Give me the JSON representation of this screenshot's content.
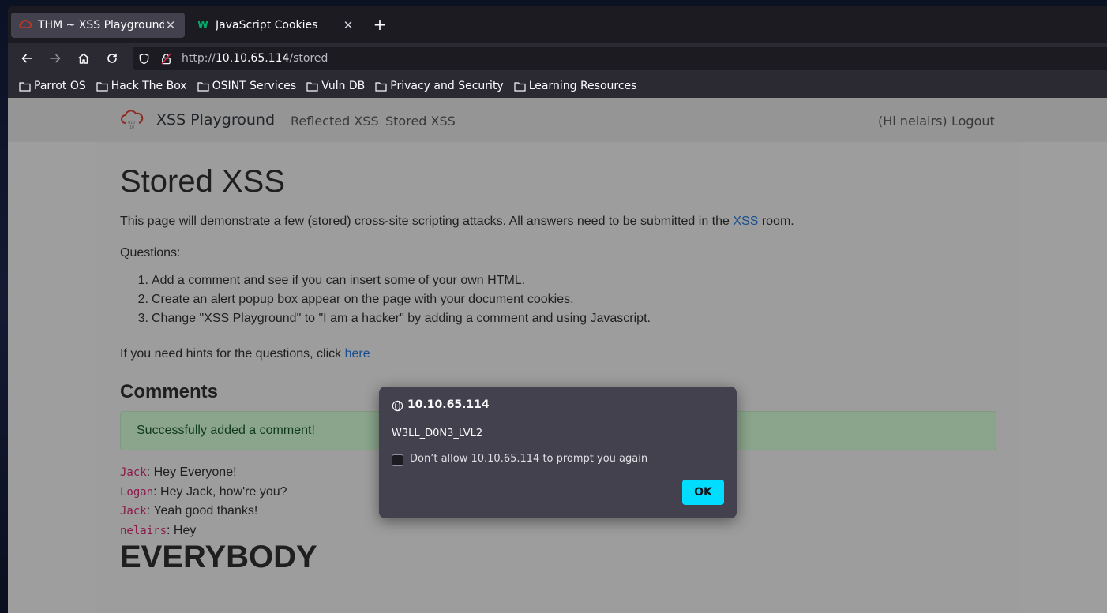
{
  "browser": {
    "tabs": [
      {
        "title": "THM ~ XSS Playground",
        "active": true
      },
      {
        "title": "JavaScript Cookies",
        "active": false
      }
    ],
    "url": {
      "prefix": "http://",
      "host": "10.10.65.114",
      "path": "/stored"
    },
    "bookmarks": [
      "Parrot OS",
      "Hack The Box",
      "OSINT Services",
      "Vuln DB",
      "Privacy and Security",
      "Learning Resources"
    ],
    "colors": {
      "accent": "#00ddff",
      "tab_active": "#42414d",
      "toolbar": "#2b2a33"
    }
  },
  "site": {
    "brand": "XSS Playground",
    "nav": {
      "reflected": "Reflected XSS",
      "stored": "Stored XSS",
      "user": "(Hi nelairs)",
      "logout": "Logout"
    }
  },
  "main": {
    "title": "Stored XSS",
    "intro_before": "This page will demonstrate a few (stored) cross-site scripting attacks. All answers need to be submitted in the ",
    "intro_link": "XSS",
    "intro_after": " room.",
    "questions_label": "Questions:",
    "questions": [
      {
        "num": "1.",
        "text": "Add a comment and see if you can insert some of your own HTML."
      },
      {
        "num": "2.",
        "text": "Create an alert popup box appear on the page with your document cookies."
      },
      {
        "num": "3.",
        "text": "Change \"XSS Playground\" to \"I am a hacker\" by adding a comment and using Javascript."
      }
    ],
    "hint_before": "If you need hints for the questions, click ",
    "hint_link": "here",
    "comments_title": "Comments",
    "success_message": "Successfully added a comment!",
    "comments": [
      {
        "author": "Jack",
        "text": ": Hey Everyone!"
      },
      {
        "author": "Logan",
        "text": ": Hey Jack, how're you?"
      },
      {
        "author": "Jack",
        "text": ": Yeah good thanks!"
      },
      {
        "author": "nelairs",
        "text": ": Hey"
      }
    ],
    "big_comment": "EVERYBODY"
  },
  "dialog": {
    "host": "10.10.65.114",
    "message": "W3LL_D0N3_LVL2",
    "checkbox_label": "Don’t allow 10.10.65.114 to prompt you again",
    "checkbox_checked": false,
    "ok_label": "OK"
  }
}
